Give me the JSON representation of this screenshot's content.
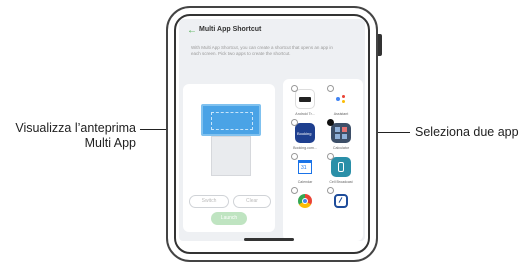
{
  "annotations": {
    "left_line1": "Visualizza l’anteprima",
    "left_line2": "Multi App",
    "right": "Seleziona due app"
  },
  "screen": {
    "title": "Multi App Shortcut",
    "description": "With Multi App Shortcut, you can create a shortcut that opens an app in each screen. Pick two apps to create the shortcut.",
    "buttons": {
      "switch": "Switch",
      "clear": "Clear",
      "launch": "Launch"
    },
    "apps": [
      {
        "name": "Android Tr...",
        "color": "#ffffff",
        "checked": false
      },
      {
        "name": "Assistant",
        "color": "#ffffff",
        "checked": false
      },
      {
        "name": "Booking.com...",
        "color": "#1e3f8f",
        "checked": false
      },
      {
        "name": "Calculator",
        "color": "#3d4f68",
        "checked": true
      },
      {
        "name": "Calendar",
        "color": "#ffffff",
        "checked": false
      },
      {
        "name": "Cell Broadcast",
        "color": "#2a8fa8",
        "checked": false
      },
      {
        "name": "Chrome",
        "color": "#ffffff",
        "checked": false
      },
      {
        "name": "Clock",
        "color": "#ffffff",
        "checked": false
      }
    ]
  }
}
